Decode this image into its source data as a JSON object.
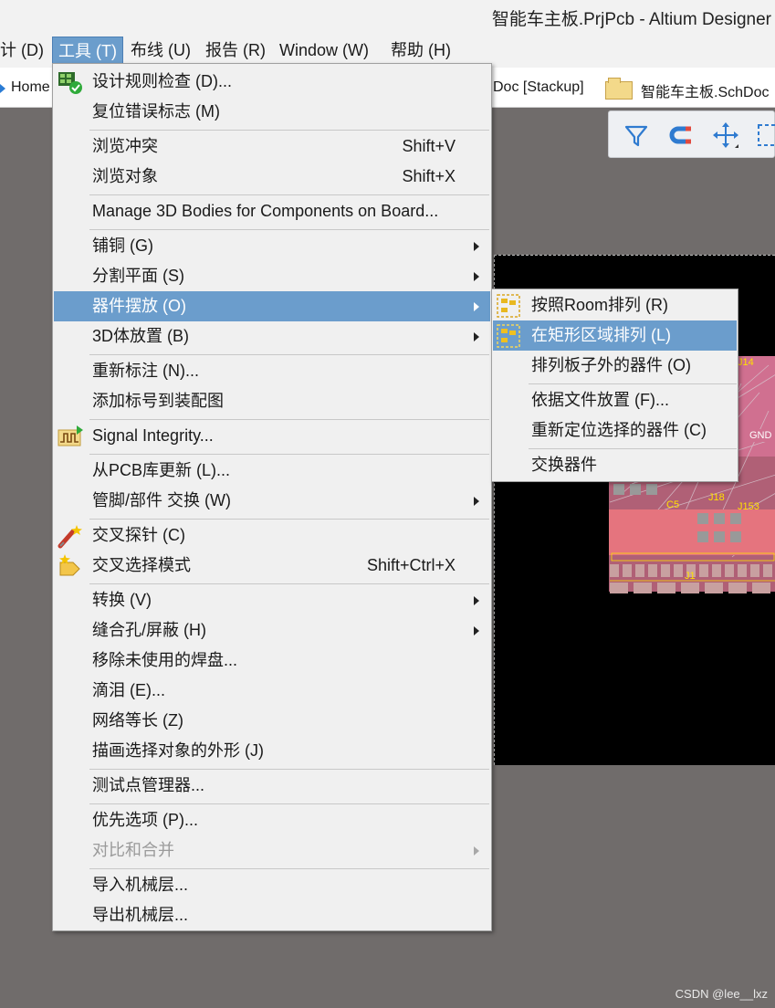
{
  "window": {
    "title": "智能车主板.PrjPcb - Altium Designer"
  },
  "menubar": {
    "items": [
      {
        "label": "计 (D)"
      },
      {
        "label": "工具 (T)"
      },
      {
        "label": "布线 (U)"
      },
      {
        "label": "报告 (R)"
      },
      {
        "label": "Window (W)"
      },
      {
        "label": "帮助 (H)"
      }
    ]
  },
  "tabs": {
    "home": "Home",
    "stackup": "Doc [Stackup]",
    "schdoc": "智能车主板.SchDoc"
  },
  "toolbar": {
    "icons": [
      "filter-icon",
      "magnet-icon",
      "move-icon",
      "select-rect-icon"
    ]
  },
  "pcb": {
    "labels": [
      "J14",
      "GND",
      "C5",
      "J18",
      "J153",
      "J1"
    ]
  },
  "tools_menu": {
    "items": [
      {
        "label": "设计规则检查 (D)...",
        "shortcut": ""
      },
      {
        "label": "复位错误标志 (M)",
        "shortcut": ""
      },
      {
        "label": "浏览冲突",
        "shortcut": "Shift+V"
      },
      {
        "label": "浏览对象",
        "shortcut": "Shift+X"
      },
      {
        "label": "Manage 3D Bodies for Components on Board...",
        "shortcut": ""
      },
      {
        "label": "铺铜 (G)",
        "shortcut": ""
      },
      {
        "label": "分割平面 (S)",
        "shortcut": ""
      },
      {
        "label": "器件摆放 (O)",
        "shortcut": ""
      },
      {
        "label": "3D体放置 (B)",
        "shortcut": ""
      },
      {
        "label": "重新标注 (N)...",
        "shortcut": ""
      },
      {
        "label": "添加标号到装配图",
        "shortcut": ""
      },
      {
        "label": "Signal Integrity...",
        "shortcut": ""
      },
      {
        "label": "从PCB库更新 (L)...",
        "shortcut": ""
      },
      {
        "label": "管脚/部件 交换 (W)",
        "shortcut": ""
      },
      {
        "label": "交叉探针 (C)",
        "shortcut": ""
      },
      {
        "label": "交叉选择模式",
        "shortcut": "Shift+Ctrl+X"
      },
      {
        "label": "转换 (V)",
        "shortcut": ""
      },
      {
        "label": "缝合孔/屏蔽 (H)",
        "shortcut": ""
      },
      {
        "label": "移除未使用的焊盘...",
        "shortcut": ""
      },
      {
        "label": "滴泪 (E)...",
        "shortcut": ""
      },
      {
        "label": "网络等长 (Z)",
        "shortcut": ""
      },
      {
        "label": "描画选择对象的外形 (J)",
        "shortcut": ""
      },
      {
        "label": "测试点管理器...",
        "shortcut": ""
      },
      {
        "label": "优先选项 (P)...",
        "shortcut": ""
      },
      {
        "label": "对比和合并",
        "shortcut": ""
      },
      {
        "label": "导入机械层...",
        "shortcut": ""
      },
      {
        "label": "导出机械层...",
        "shortcut": ""
      }
    ]
  },
  "placement_submenu": {
    "items": [
      {
        "label": "按照Room排列 (R)"
      },
      {
        "label": "在矩形区域排列 (L)"
      },
      {
        "label": "排列板子外的器件 (O)"
      },
      {
        "label": "依据文件放置 (F)..."
      },
      {
        "label": "重新定位选择的器件 (C)"
      },
      {
        "label": "交换器件"
      }
    ]
  },
  "colors": {
    "highlight": "#6b9dcc",
    "menu_bg": "#f0f0f0",
    "workspace_bg": "#706c6b"
  },
  "watermark": "CSDN @lee__lxz"
}
